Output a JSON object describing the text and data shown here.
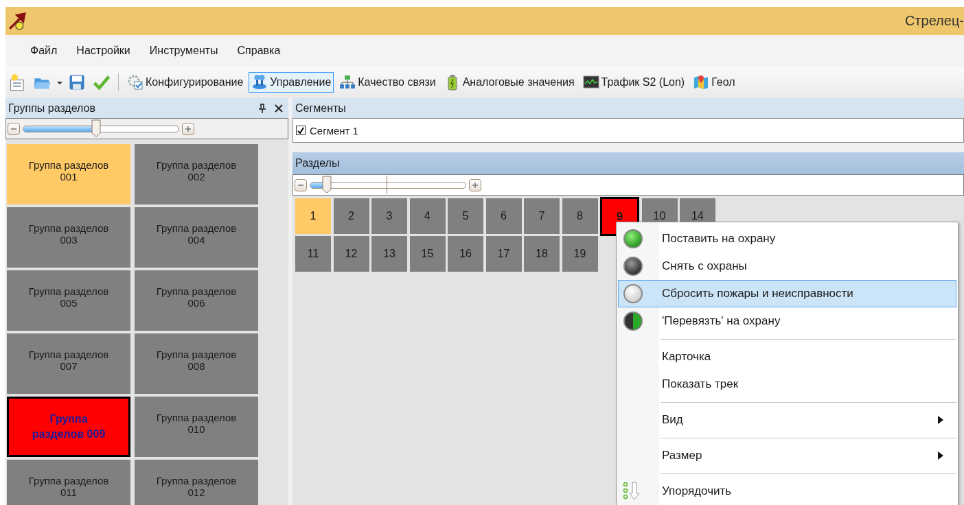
{
  "window": {
    "title": "Стрелец-"
  },
  "menu_bar": [
    "Файл",
    "Настройки",
    "Инструменты",
    "Справка"
  ],
  "toolbar": {
    "buttons": [
      {
        "label": "Конфигурирование",
        "selected": false
      },
      {
        "label": "Управление",
        "selected": true
      },
      {
        "label": "Качество связи",
        "selected": false
      },
      {
        "label": "Аналоговые значения",
        "selected": false
      },
      {
        "label": "Трафик S2 (Lon)",
        "selected": false
      },
      {
        "label": "Геол",
        "selected": false
      }
    ]
  },
  "groups_panel": {
    "title": "Группы разделов",
    "zoom": {
      "level": 0.47
    },
    "tiles": [
      {
        "label": "Группа разделов 001",
        "selected": true,
        "alarm": false
      },
      {
        "label": "Группа разделов 002",
        "selected": false,
        "alarm": false
      },
      {
        "label": "Группа разделов 003",
        "selected": false,
        "alarm": false
      },
      {
        "label": "Группа разделов 004",
        "selected": false,
        "alarm": false
      },
      {
        "label": "Группа разделов 005",
        "selected": false,
        "alarm": false
      },
      {
        "label": "Группа разделов 006",
        "selected": false,
        "alarm": false
      },
      {
        "label": "Группа разделов 007",
        "selected": false,
        "alarm": false
      },
      {
        "label": "Группа разделов 008",
        "selected": false,
        "alarm": false
      },
      {
        "label": "Группа разделов 009",
        "selected": false,
        "alarm": true
      },
      {
        "label": "Группа разделов 010",
        "selected": false,
        "alarm": false
      },
      {
        "label": "Группа разделов 011",
        "selected": false,
        "alarm": false
      },
      {
        "label": "Группа разделов 012",
        "selected": false,
        "alarm": false
      }
    ]
  },
  "segments_panel": {
    "title": "Сегменты",
    "items": [
      {
        "label": "Сегмент 1",
        "checked": true
      }
    ]
  },
  "sections_panel": {
    "title": "Разделы",
    "zoom": {
      "level": 0.11
    },
    "rows": [
      [
        {
          "label": "1",
          "selected": true,
          "alarm": false
        },
        {
          "label": "2",
          "selected": false,
          "alarm": false
        },
        {
          "label": "3",
          "selected": false,
          "alarm": false
        },
        {
          "label": "4",
          "selected": false,
          "alarm": false
        },
        {
          "label": "5",
          "selected": false,
          "alarm": false
        },
        {
          "label": "6",
          "selected": false,
          "alarm": false
        },
        {
          "label": "7",
          "selected": false,
          "alarm": false
        },
        {
          "label": "8",
          "selected": false,
          "alarm": false
        },
        {
          "label": "9",
          "selected": false,
          "alarm": true
        },
        {
          "label": "10",
          "selected": false,
          "alarm": false
        },
        {
          "label": "14",
          "selected": false,
          "alarm": false
        }
      ],
      [
        {
          "label": "11",
          "selected": false,
          "alarm": false
        },
        {
          "label": "12",
          "selected": false,
          "alarm": false
        },
        {
          "label": "13",
          "selected": false,
          "alarm": false
        },
        {
          "label": "15",
          "selected": false,
          "alarm": false
        },
        {
          "label": "16",
          "selected": false,
          "alarm": false
        },
        {
          "label": "17",
          "selected": false,
          "alarm": false
        },
        {
          "label": "18",
          "selected": false,
          "alarm": false
        },
        {
          "label": "19",
          "selected": false,
          "alarm": false
        }
      ]
    ]
  },
  "context_menu": {
    "items": [
      {
        "kind": "command",
        "label": "Поставить на охрану",
        "selected": false
      },
      {
        "kind": "command",
        "label": "Снять с охраны",
        "selected": false
      },
      {
        "kind": "command",
        "label": "Сбросить пожары и неисправности",
        "selected": true
      },
      {
        "kind": "command",
        "label": "'Перевязть' на охрану",
        "selected": false
      },
      {
        "kind": "separator"
      },
      {
        "kind": "command",
        "label": "Карточка",
        "selected": false
      },
      {
        "kind": "command",
        "label": "Показать трек",
        "selected": false
      },
      {
        "kind": "separator"
      },
      {
        "kind": "submenu",
        "label": "Вид",
        "selected": false
      },
      {
        "kind": "separator"
      },
      {
        "kind": "submenu",
        "label": "Размер",
        "selected": false
      },
      {
        "kind": "separator"
      },
      {
        "kind": "command",
        "label": "Упорядочить",
        "selected": false
      }
    ]
  }
}
